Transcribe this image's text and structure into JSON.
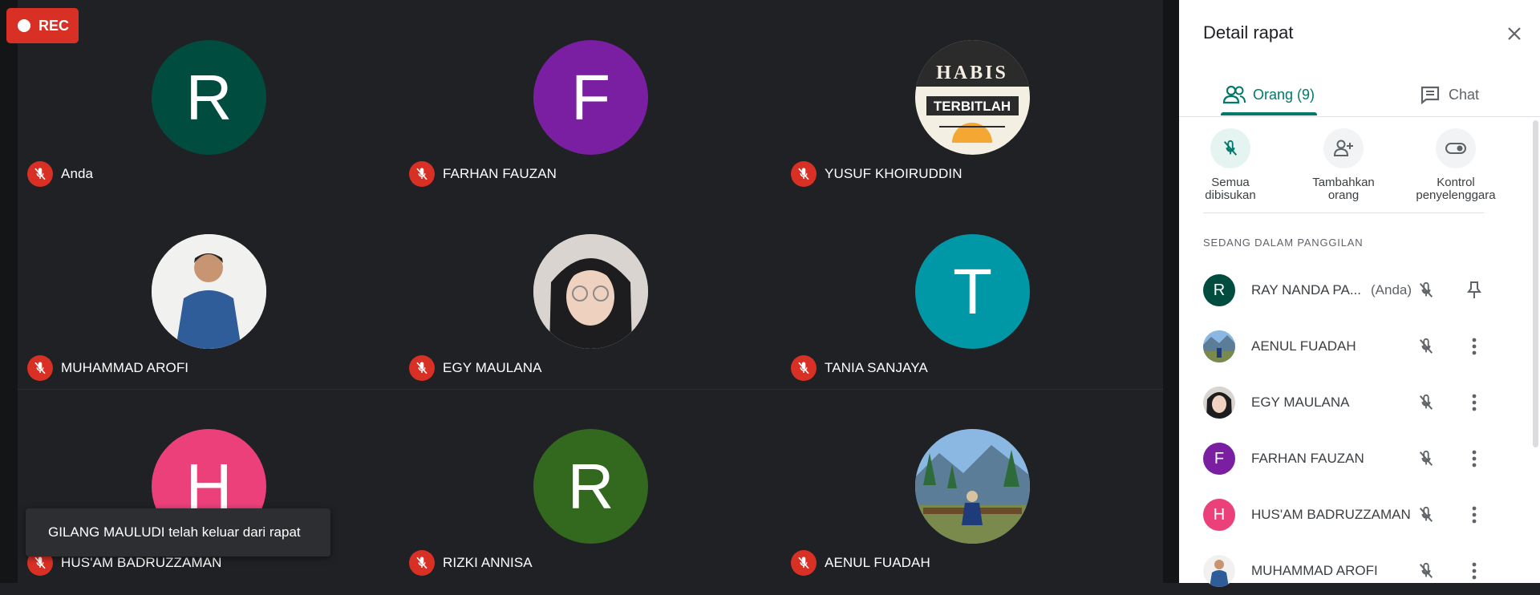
{
  "recording": {
    "label": "REC"
  },
  "tiles": [
    {
      "name": "Anda",
      "initial": "R",
      "color": "#004d40",
      "kind": "letter"
    },
    {
      "name": "FARHAN FAUZAN",
      "initial": "F",
      "color": "#7b1fa2",
      "kind": "letter"
    },
    {
      "name": "YUSUF KHOIRUDDIN",
      "kind": "logo",
      "logo_text": [
        "HABIS",
        "TERBITLAH"
      ]
    },
    {
      "name": "MUHAMMAD AROFI",
      "kind": "photo-man"
    },
    {
      "name": "EGY MAULANA",
      "kind": "photo-woman"
    },
    {
      "name": "TANIA SANJAYA",
      "initial": "T",
      "color": "#0097a7",
      "kind": "letter"
    },
    {
      "name": "HUS'AM BADRUZZAMAN",
      "initial": "H",
      "color": "#ec407a",
      "kind": "letter"
    },
    {
      "name": "RIZKI ANNISA",
      "initial": "R",
      "color": "#33691e",
      "kind": "letter"
    },
    {
      "name": "AENUL FUADAH",
      "kind": "photo-landscape"
    }
  ],
  "toast": {
    "text": "GILANG MAULUDI telah keluar dari rapat"
  },
  "panel": {
    "title": "Detail rapat",
    "tabs": {
      "people": "Orang (9)",
      "chat": "Chat"
    },
    "actions": {
      "mute_all": "Semua dibisukan",
      "add_people": "Tambahkan orang",
      "host_controls": "Kontrol penyelenggara"
    },
    "section_label": "SEDANG DALAM PANGGILAN",
    "participants": [
      {
        "name": "RAY NANDA PA...",
        "suffix": "(Anda)",
        "initial": "R",
        "color": "#004d40",
        "kind": "letter",
        "trailing": "pin-icon"
      },
      {
        "name": "AENUL FUADAH",
        "kind": "photo-landscape",
        "trailing": "more-icon"
      },
      {
        "name": "EGY MAULANA",
        "kind": "photo-woman",
        "trailing": "more-icon"
      },
      {
        "name": "FARHAN FAUZAN",
        "initial": "F",
        "color": "#7b1fa2",
        "kind": "letter",
        "trailing": "more-icon"
      },
      {
        "name": "HUS'AM BADRUZZAMAN",
        "initial": "H",
        "color": "#ec407a",
        "kind": "letter",
        "trailing": "more-icon"
      },
      {
        "name": "MUHAMMAD AROFI",
        "kind": "photo-man",
        "trailing": "more-icon"
      }
    ]
  },
  "colors": {
    "accent": "#00796b",
    "muted_red": "#d93025",
    "stage_bg": "#202124"
  }
}
